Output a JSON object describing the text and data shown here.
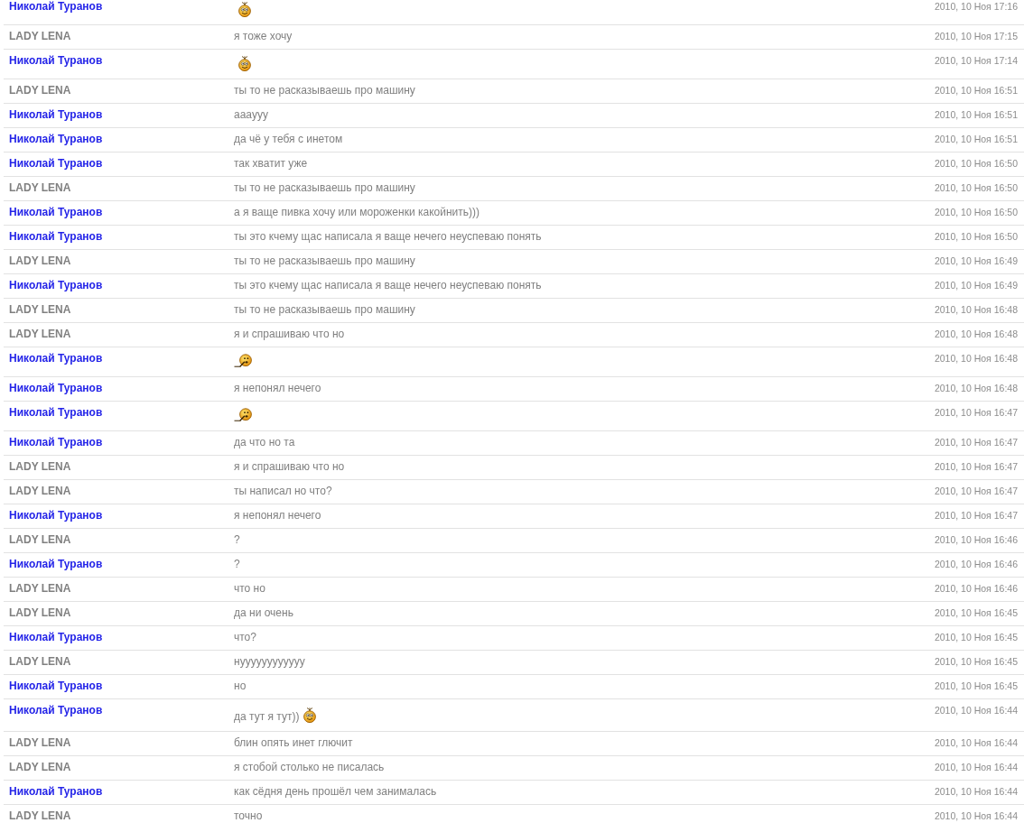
{
  "messages": [
    {
      "sender": "Николай Туранов",
      "color": "#2424e8",
      "kind": "smiley",
      "time": "2010, 10 Ноя 17:16"
    },
    {
      "sender": "LADY LENA",
      "color": "#808080",
      "kind": "text",
      "text": "я тоже хочу",
      "time": "2010, 10 Ноя 17:15"
    },
    {
      "sender": "Николай Туранов",
      "color": "#2424e8",
      "kind": "smiley",
      "time": "2010, 10 Ноя 17:14"
    },
    {
      "sender": "LADY LENA",
      "color": "#808080",
      "kind": "text",
      "text": "ты то не расказываешь про машину",
      "time": "2010, 10 Ноя 16:51"
    },
    {
      "sender": "Николай Туранов",
      "color": "#2424e8",
      "kind": "text",
      "text": "аааууу",
      "time": "2010, 10 Ноя 16:51"
    },
    {
      "sender": "Николай Туранов",
      "color": "#2424e8",
      "kind": "text",
      "text": "да чё у тебя с инетом",
      "time": "2010, 10 Ноя 16:51"
    },
    {
      "sender": "Николай Туранов",
      "color": "#2424e8",
      "kind": "text",
      "text": "так хватит уже",
      "time": "2010, 10 Ноя 16:50"
    },
    {
      "sender": "LADY LENA",
      "color": "#808080",
      "kind": "text",
      "text": "ты то не расказываешь про машину",
      "time": "2010, 10 Ноя 16:50"
    },
    {
      "sender": "Николай Туранов",
      "color": "#2424e8",
      "kind": "text",
      "text": "а я ваще пивка хочу или мороженки какойнить)))",
      "time": "2010, 10 Ноя 16:50"
    },
    {
      "sender": "Николай Туранов",
      "color": "#2424e8",
      "kind": "text",
      "text": "ты это кчему щас написала я ваще нечего неуспеваю понять",
      "time": "2010, 10 Ноя 16:50"
    },
    {
      "sender": "LADY LENA",
      "color": "#808080",
      "kind": "text",
      "text": "ты то не расказываешь про машину",
      "time": "2010, 10 Ноя 16:49"
    },
    {
      "sender": "Николай Туранов",
      "color": "#2424e8",
      "kind": "text",
      "text": "ты это кчему щас написала я ваще нечего неуспеваю понять",
      "time": "2010, 10 Ноя 16:49"
    },
    {
      "sender": "LADY LENA",
      "color": "#808080",
      "kind": "text",
      "text": "ты то не расказываешь про машину",
      "time": "2010, 10 Ноя 16:48"
    },
    {
      "sender": "LADY LENA",
      "color": "#808080",
      "kind": "text",
      "text": "я и спрашиваю что но",
      "time": "2010, 10 Ноя 16:48"
    },
    {
      "sender": "Николай Туранов",
      "color": "#2424e8",
      "kind": "scribe",
      "time": "2010, 10 Ноя 16:48"
    },
    {
      "sender": "Николай Туранов",
      "color": "#2424e8",
      "kind": "text",
      "text": "я непонял нечего",
      "time": "2010, 10 Ноя 16:48"
    },
    {
      "sender": "Николай Туранов",
      "color": "#2424e8",
      "kind": "scribe",
      "time": "2010, 10 Ноя 16:47"
    },
    {
      "sender": "Николай Туранов",
      "color": "#2424e8",
      "kind": "text",
      "text": "да что но та",
      "time": "2010, 10 Ноя 16:47"
    },
    {
      "sender": "LADY LENA",
      "color": "#808080",
      "kind": "text",
      "text": "я и спрашиваю что но",
      "time": "2010, 10 Ноя 16:47"
    },
    {
      "sender": "LADY LENA",
      "color": "#808080",
      "kind": "text",
      "text": "ты написал но что?",
      "time": "2010, 10 Ноя 16:47"
    },
    {
      "sender": "Николай Туранов",
      "color": "#2424e8",
      "kind": "text",
      "text": "я непонял нечего",
      "time": "2010, 10 Ноя 16:47"
    },
    {
      "sender": "LADY LENA",
      "color": "#808080",
      "kind": "text",
      "text": "?",
      "time": "2010, 10 Ноя 16:46"
    },
    {
      "sender": "Николай Туранов",
      "color": "#2424e8",
      "kind": "text",
      "text": "?",
      "time": "2010, 10 Ноя 16:46"
    },
    {
      "sender": "LADY LENA",
      "color": "#808080",
      "kind": "text",
      "text": "что но",
      "time": "2010, 10 Ноя 16:46"
    },
    {
      "sender": "LADY LENA",
      "color": "#808080",
      "kind": "text",
      "text": "да ни очень",
      "time": "2010, 10 Ноя 16:45"
    },
    {
      "sender": "Николай Туранов",
      "color": "#2424e8",
      "kind": "text",
      "text": "что?",
      "time": "2010, 10 Ноя 16:45"
    },
    {
      "sender": "LADY LENA",
      "color": "#808080",
      "kind": "text",
      "text": "нуууууууууууу",
      "time": "2010, 10 Ноя 16:45"
    },
    {
      "sender": "Николай Туранов",
      "color": "#2424e8",
      "kind": "text",
      "text": "но",
      "time": "2010, 10 Ноя 16:45"
    },
    {
      "sender": "Николай Туранов",
      "color": "#2424e8",
      "kind": "mixed",
      "text": "да тут я тут))",
      "time": "2010, 10 Ноя 16:44"
    },
    {
      "sender": "LADY LENA",
      "color": "#808080",
      "kind": "text",
      "text": "блин опять инет глючит",
      "time": "2010, 10 Ноя 16:44"
    },
    {
      "sender": "LADY LENA",
      "color": "#808080",
      "kind": "text",
      "text": "я стобой столько не писалась",
      "time": "2010, 10 Ноя 16:44"
    },
    {
      "sender": "Николай Туранов",
      "color": "#2424e8",
      "kind": "text",
      "text": "как сёдня день прошёл чем занималась",
      "time": "2010, 10 Ноя 16:44"
    },
    {
      "sender": "LADY LENA",
      "color": "#808080",
      "kind": "text",
      "text": "точно",
      "time": "2010, 10 Ноя 16:44"
    }
  ]
}
